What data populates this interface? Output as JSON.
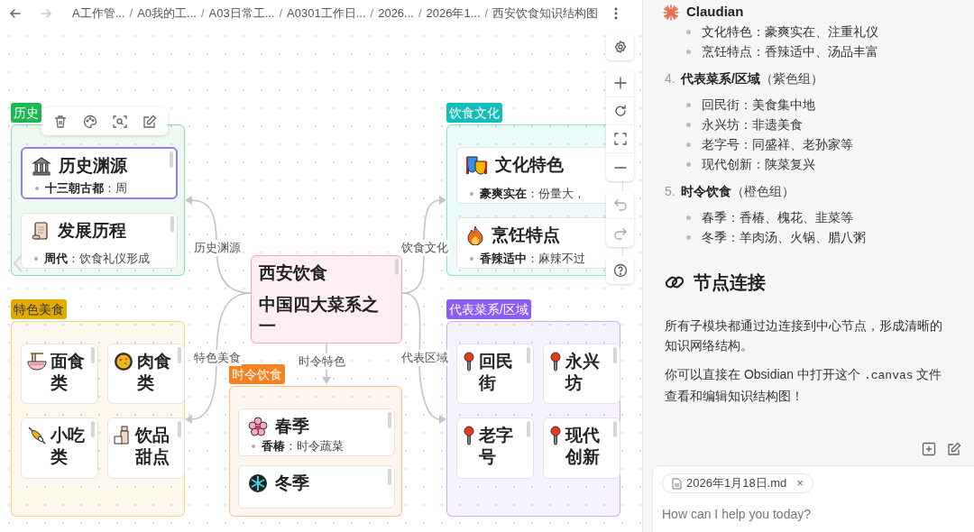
{
  "nav": {
    "back_disabled": false,
    "forward_disabled": true
  },
  "breadcrumbs": [
    {
      "label": "A工作管..."
    },
    {
      "separator": "/",
      "label": "A0我的工..."
    },
    {
      "separator": "/",
      "label": "A03日常工..."
    },
    {
      "separator": "/",
      "label": "A0301工作日..."
    },
    {
      "separator": "/",
      "label": "2026..."
    },
    {
      "separator": "/",
      "label": "2026年1..."
    },
    {
      "separator": "/",
      "label": "西安饮食知识结构图"
    }
  ],
  "canvas": {
    "center": {
      "title": "西安饮食",
      "subtitle": "中国四大菜系之一"
    },
    "groups": [
      {
        "label": "历史",
        "color": "#1bb954",
        "kind": "list",
        "nodes": [
          {
            "title": "历史渊源",
            "bullet": "**十三朝古都**：周",
            "selected": true
          },
          {
            "title": "发展历程",
            "bullet": "**周代**：饮食礼仪形成",
            "selected": false
          }
        ]
      },
      {
        "label": "饮食文化",
        "color": "#14bcbc",
        "kind": "list",
        "nodes": [
          {
            "title": "文化特色",
            "bullet": "**豪爽实在**：份量大，",
            "selected": false
          },
          {
            "title": "烹饪特点",
            "bullet": "**香辣适中**：麻辣不过",
            "selected": false
          }
        ]
      },
      {
        "label": "特色美食",
        "color": "#e0ac00",
        "kind": "grid",
        "nodes": [
          {
            "title": "面食类",
            "selected": false
          },
          {
            "title": "肉食类",
            "selected": false
          },
          {
            "title": "小吃类",
            "selected": false
          },
          {
            "title": "饮品甜点",
            "selected": false
          }
        ]
      },
      {
        "label": "代表菜系/区域",
        "color": "#8b5cf6",
        "kind": "grid",
        "nodes": [
          {
            "title": "回民街",
            "selected": false
          },
          {
            "title": "永兴坊",
            "selected": false
          },
          {
            "title": "老字号",
            "selected": false
          },
          {
            "title": "现代创新",
            "selected": false
          }
        ]
      },
      {
        "label": "时令饮食",
        "color": "#f5821f",
        "kind": "list",
        "nodes": [
          {
            "title": "春季",
            "bullet": "**香椿**：时令蔬菜",
            "selected": false
          },
          {
            "title": "冬季",
            "selected": false
          }
        ]
      }
    ],
    "edges": [
      {
        "label": "历史渊源"
      },
      {
        "label": "饮食文化"
      },
      {
        "label": "特色美食"
      },
      {
        "label": "时令特色"
      },
      {
        "label": "代表区域"
      }
    ]
  },
  "chat": {
    "assistant": "Claudian",
    "blocks": [
      {
        "kind": "bullets",
        "items": [
          "文化特色：豪爽实在、注重礼仪",
          "烹饪特点：香辣适中、汤品丰富"
        ]
      },
      {
        "kind": "numbered",
        "number": "4.",
        "title": "代表菜系/区域",
        "note": "（紫色组）",
        "items": [
          "回民街：美食集中地",
          "永兴坊：非遗美食",
          "老字号：同盛祥、老孙家等",
          "现代创新：陕菜复兴"
        ]
      },
      {
        "kind": "numbered",
        "number": "5.",
        "title": "时令饮食",
        "note": "（橙色组）",
        "items": [
          "春季：香椿、槐花、韭菜等",
          "冬季：羊肉汤、火锅、腊八粥"
        ]
      },
      {
        "kind": "heading",
        "text": "节点连接"
      },
      {
        "kind": "paragraph",
        "parts": [
          {
            "kind": "text",
            "text": "所有子模块都通过边连接到中心节点，形成清晰的知识网络结构。"
          }
        ]
      },
      {
        "kind": "paragraph",
        "parts": [
          {
            "kind": "text",
            "text": "你可以直接在 Obsidian 中打开这个 "
          },
          {
            "kind": "code",
            "text": ".canvas"
          },
          {
            "kind": "text",
            "text": " 文件查看和编辑知识结构图！"
          }
        ]
      }
    ],
    "attachment": "2026年1月18日.md",
    "remove": "×",
    "placeholder": "How can I help you today?"
  }
}
